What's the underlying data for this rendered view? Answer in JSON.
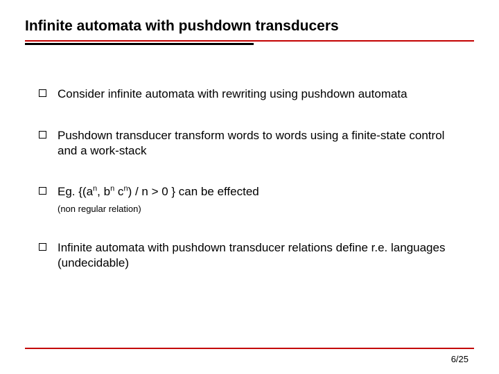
{
  "title": "Infinite automata with pushdown transducers",
  "bullets": {
    "b1": "Consider infinite automata with rewriting using pushdown automata",
    "b2": "Pushdown transducer transform words to words using a finite-state control and a work-stack",
    "b3_prefix": "Eg. {(a",
    "b3_mid1": ", b",
    "b3_mid2": " c",
    "b3_suffix": ") / n > 0 } can be effected",
    "b3_sup": "n",
    "b3_note": "(non regular relation)",
    "b4": "Infinite automata with pushdown transducer relations define r.e. languages (undecidable)"
  },
  "pagenum": "6/25"
}
